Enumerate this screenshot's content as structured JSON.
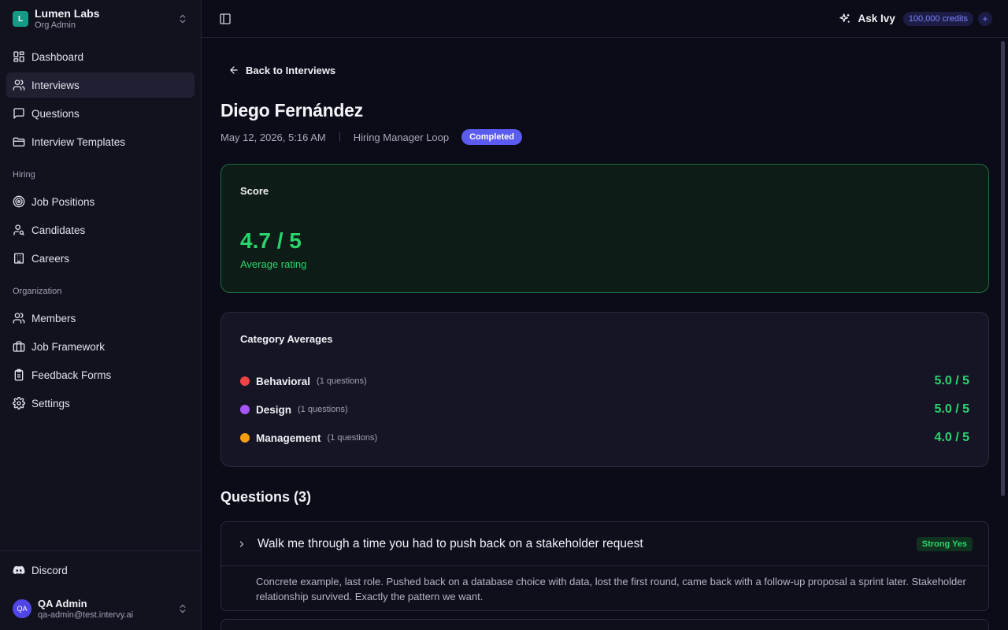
{
  "org": {
    "initial": "L",
    "name": "Lumen Labs",
    "role": "Org Admin"
  },
  "nav": {
    "main": [
      {
        "label": "Dashboard",
        "icon": "dashboard-icon"
      },
      {
        "label": "Interviews",
        "icon": "users-icon",
        "active": true
      },
      {
        "label": "Questions",
        "icon": "message-icon"
      },
      {
        "label": "Interview Templates",
        "icon": "folder-icon"
      }
    ],
    "hiring_title": "Hiring",
    "hiring": [
      {
        "label": "Job Positions",
        "icon": "target-icon"
      },
      {
        "label": "Candidates",
        "icon": "user-search-icon"
      },
      {
        "label": "Careers",
        "icon": "building-icon"
      }
    ],
    "org_title": "Organization",
    "organization": [
      {
        "label": "Members",
        "icon": "users-icon"
      },
      {
        "label": "Job Framework",
        "icon": "briefcase-icon"
      },
      {
        "label": "Feedback Forms",
        "icon": "clipboard-icon"
      },
      {
        "label": "Settings",
        "icon": "gear-icon"
      }
    ]
  },
  "discord": {
    "label": "Discord"
  },
  "user": {
    "initials": "QA",
    "name": "QA Admin",
    "email": "qa-admin@test.intervy.ai"
  },
  "topbar": {
    "ask_label": "Ask Ivy",
    "credits": "100,000 credits",
    "plus": "+"
  },
  "page": {
    "back_label": "Back to Interviews",
    "candidate_name": "Diego Fernández",
    "date": "May 12, 2026, 5:16 AM",
    "loop": "Hiring Manager Loop",
    "status": "Completed"
  },
  "score": {
    "title": "Score",
    "value": "4.7 / 5",
    "subtitle": "Average rating"
  },
  "categories": {
    "title": "Category Averages",
    "items": [
      {
        "name": "Behavioral",
        "count": "(1 questions)",
        "score": "5.0 / 5",
        "color": "#ef4444"
      },
      {
        "name": "Design",
        "count": "(1 questions)",
        "score": "5.0 / 5",
        "color": "#a855f7"
      },
      {
        "name": "Management",
        "count": "(1 questions)",
        "score": "4.0 / 5",
        "color": "#f59e0b"
      }
    ]
  },
  "questions": {
    "heading": "Questions (3)",
    "items": [
      {
        "text": "Walk me through a time you had to push back on a stakeholder request",
        "verdict": "Strong Yes",
        "notes": "Concrete example, last role. Pushed back on a database choice with data, lost the first round, came back with a follow-up proposal a sprint later. Stakeholder relationship survived. Exactly the pattern we want."
      }
    ]
  },
  "colors": {
    "accent": "#5b5bf0",
    "success": "#2bd46d",
    "background": "#0c0c18"
  }
}
